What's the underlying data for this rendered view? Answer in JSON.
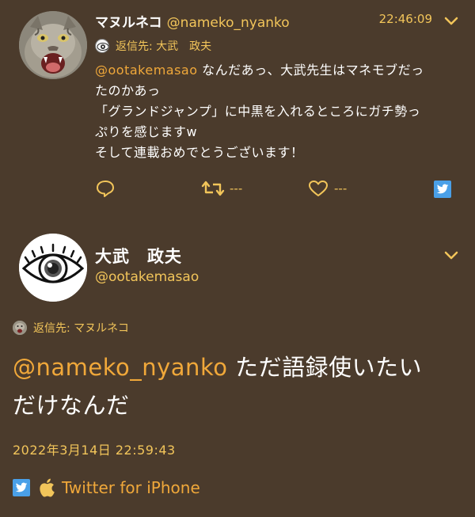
{
  "reply_tweet": {
    "author_name": "マヌルネコ",
    "author_handle": "@nameko_nyanko",
    "time": "22:46:09",
    "reply_to_label": "返信先: 大武　政夫",
    "mention": "@ootakemasao",
    "body_lines": [
      " なんだあっ、大武先生はマネモブだっ",
      "たのかあっ",
      "「グランドジャンプ」に中黒を入れるところにガチ勢っ",
      "ぷりを感じますw",
      "そして連載おめでとうございます！"
    ],
    "retweet_count": "---",
    "like_count": "---"
  },
  "main_tweet": {
    "author_name": "大武　政夫",
    "author_handle": "@ootakemasao",
    "reply_to_label": "返信先: マヌルネコ",
    "mention": "@nameko_nyanko",
    "body_line1_rest": " ただ語録使いたい",
    "body_line2": "だけなんだ",
    "date": "2022年3月14日 22:59:43",
    "source": "Twitter for iPhone"
  },
  "colors": {
    "background": "#4b3b2c",
    "accent": "#f0a83a",
    "gold": "#f2c55a",
    "twitter_blue": "#4aa0e8"
  },
  "icons": {
    "reply": "speech-bubble-icon",
    "retweet": "retweet-icon",
    "like": "heart-icon",
    "twitter": "twitter-bird-icon",
    "apple": "apple-icon",
    "menu": "chevron-down-icon"
  }
}
